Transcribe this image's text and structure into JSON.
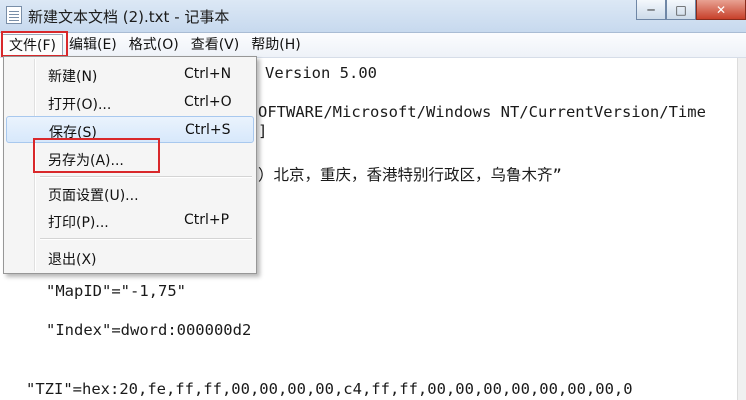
{
  "window": {
    "title": "新建文本文档 (2).txt - 记事本",
    "minimize": "─",
    "maximize": "□",
    "close": "✕"
  },
  "menubar": {
    "file": "文件(F)",
    "edit": "编辑(E)",
    "format": "格式(O)",
    "view": "查看(V)",
    "help": "帮助(H)"
  },
  "file_menu": {
    "new": {
      "label": "新建(N)",
      "shortcut": "Ctrl+N"
    },
    "open": {
      "label": "打开(O)...",
      "shortcut": "Ctrl+O"
    },
    "save": {
      "label": "保存(S)",
      "shortcut": "Ctrl+S"
    },
    "save_as": {
      "label": "另存为(A)..."
    },
    "page_setup": {
      "label": "页面设置(U)..."
    },
    "print": {
      "label": "打印(P)...",
      "shortcut": "Ctrl+P"
    },
    "exit": {
      "label": "退出(X)"
    }
  },
  "editor": {
    "lines": [
      "Version 5.00",
      "OFTWARE/Microsoft/Windows NT/CurrentVersion/Time",
      "]",
      "）北京，重庆，香港特别行政区，乌鲁木齐”",
      "\"MapID\"=\"-1,75\"",
      "\"Index\"=dword:000000d2",
      "\"TZI\"=hex:20,fe,ff,ff,00,00,00,00,c4,ff,ff,00,00,00,00,00,00,00,0"
    ]
  },
  "colors": {
    "highlight_box": "#d9282b",
    "menu_hover": "#d7e8fb"
  }
}
